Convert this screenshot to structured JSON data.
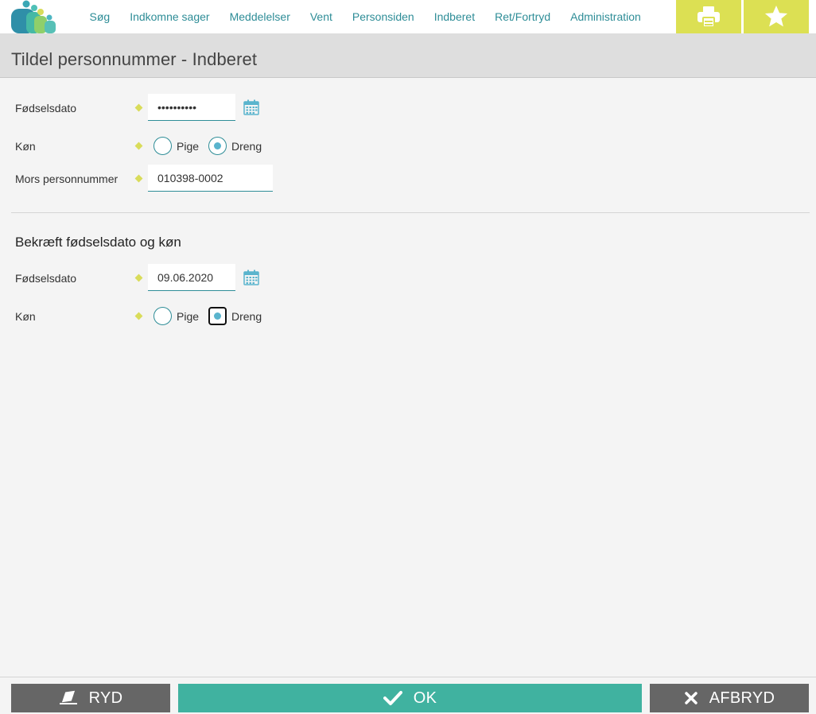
{
  "nav": {
    "items": [
      {
        "label": "Søg"
      },
      {
        "label": "Indkomne sager"
      },
      {
        "label": "Meddelelser"
      },
      {
        "label": "Vent"
      },
      {
        "label": "Personsiden"
      },
      {
        "label": "Indberet"
      },
      {
        "label": "Ret/Fortryd"
      },
      {
        "label": "Administration"
      }
    ],
    "icons": [
      "printer-icon",
      "star-icon"
    ]
  },
  "page": {
    "title": "Tildel personnummer - Indberet"
  },
  "form": {
    "birthdate_label": "Fødselsdato",
    "birthdate_value": "••••••••••",
    "gender_label": "Køn",
    "gender_options": [
      "Pige",
      "Dreng"
    ],
    "gender_selected": "Dreng",
    "mother_cpr_label": "Mors personnummer",
    "mother_cpr_value": "010398-0002"
  },
  "confirm": {
    "section_title": "Bekræft fødselsdato og køn",
    "birthdate_label": "Fødselsdato",
    "birthdate_value": "09.06.2020",
    "gender_label": "Køn",
    "gender_options": [
      "Pige",
      "Dreng"
    ],
    "gender_selected": "Dreng"
  },
  "actions": {
    "clear_label": "RYD",
    "ok_label": "OK",
    "cancel_label": "AFBRYD"
  },
  "colors": {
    "accent_teal": "#2e8d97",
    "tool_yellow": "#dce053",
    "ok_green": "#40b2a0",
    "button_gray": "#666666"
  }
}
